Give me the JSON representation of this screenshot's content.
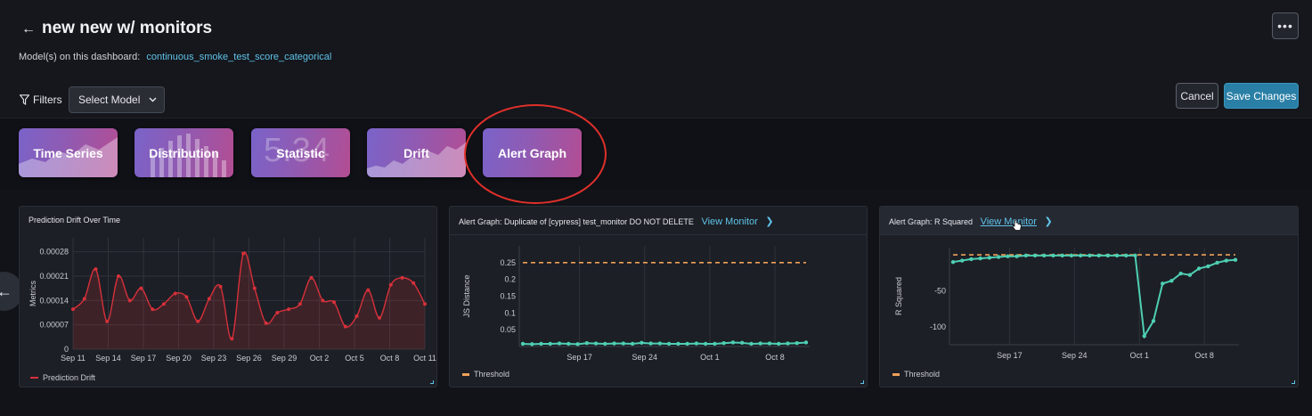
{
  "header": {
    "back_icon": "arrow-left-icon",
    "title": "new new w/ monitors",
    "models_label": "Model(s) on this dashboard:",
    "model_link": "continuous_smoke_test_score_categorical",
    "more_icon": "ellipsis-icon",
    "more_label": "•••"
  },
  "filters": {
    "icon": "funnel-icon",
    "label": "Filters",
    "select_label": "Select Model",
    "select_icon": "chevron-down-icon"
  },
  "actions": {
    "cancel_label": "Cancel",
    "save_label": "Save Changes"
  },
  "widgets": [
    {
      "label": "Time Series"
    },
    {
      "label": "Distribution"
    },
    {
      "label": "Statistic",
      "bg_text": "5.34"
    },
    {
      "label": "Drift"
    },
    {
      "label": "Alert Graph"
    }
  ],
  "colors": {
    "accent": "#5fc3ea",
    "drift_line": "#d6303a",
    "alert_line": "#4ecfb3",
    "threshold": "#f0a05a",
    "highlight": "#e0302a"
  },
  "panels": {
    "drift": {
      "title": "Prediction Drift Over Time",
      "legend": "Prediction Drift"
    },
    "alert_js": {
      "title": "Alert Graph: Duplicate of [cypress] test_monitor DO NOT DELETE",
      "link": "View Monitor",
      "legend": "Threshold"
    },
    "alert_r2": {
      "title": "Alert Graph: R Squared",
      "link": "View Monitor",
      "legend": "Threshold"
    }
  },
  "chart_data": [
    {
      "type": "line",
      "title": "Prediction Drift Over Time",
      "ylabel": "Metrics",
      "xlabel": "",
      "x_ticks": [
        "Sep 11",
        "Sep 14",
        "Sep 17",
        "Sep 20",
        "Sep 23",
        "Sep 26",
        "Sep 29",
        "Oct 2",
        "Oct 5",
        "Oct 8",
        "Oct 11"
      ],
      "y_ticks": [
        "0",
        "0.00007",
        "0.00014",
        "0.00021",
        "0.00028"
      ],
      "ylim": [
        0,
        0.00032
      ],
      "xlim": [
        0,
        31
      ],
      "series": [
        {
          "name": "Prediction Drift",
          "x": [
            0,
            1,
            2,
            3,
            4,
            5,
            6,
            7,
            8,
            9,
            10,
            11,
            12,
            13,
            14,
            15,
            16,
            17,
            18,
            19,
            20,
            21,
            22,
            23,
            24,
            25,
            26,
            27,
            28,
            29,
            30,
            31
          ],
          "y": [
            0.000115,
            0.000145,
            0.00023,
            8e-05,
            0.00021,
            0.00014,
            0.000175,
            0.000115,
            0.00013,
            0.00016,
            0.00015,
            8e-05,
            0.000145,
            0.00018,
            3e-05,
            0.000275,
            0.000175,
            7.5e-05,
            0.000105,
            0.000115,
            0.00013,
            0.000205,
            0.00014,
            0.000135,
            6.5e-05,
            9.5e-05,
            0.00017,
            9e-05,
            0.000185,
            0.000205,
            0.00019,
            0.00013
          ]
        }
      ]
    },
    {
      "type": "line",
      "title": "Alert Graph: Duplicate of [cypress] test_monitor DO NOT DELETE",
      "ylabel": "JS Distance",
      "xlabel": "",
      "x_ticks": [
        "Sep 17",
        "Sep 24",
        "Oct 1",
        "Oct 8"
      ],
      "y_ticks": [
        "0.05",
        "0.1",
        "0.15",
        "0.2",
        "0.25"
      ],
      "ylim": [
        0,
        0.3
      ],
      "threshold": 0.25,
      "series": [
        {
          "name": "",
          "x": [
            0,
            1,
            2,
            3,
            4,
            5,
            6,
            7,
            8,
            9,
            10,
            11,
            12,
            13,
            14,
            15,
            16,
            17,
            18,
            19,
            20,
            21,
            22,
            23,
            24,
            25,
            26,
            27,
            28,
            29,
            30,
            31
          ],
          "y": [
            0.008,
            0.007,
            0.008,
            0.008,
            0.009,
            0.008,
            0.007,
            0.01,
            0.009,
            0.008,
            0.009,
            0.009,
            0.008,
            0.011,
            0.009,
            0.009,
            0.008,
            0.008,
            0.008,
            0.009,
            0.008,
            0.008,
            0.01,
            0.012,
            0.011,
            0.008,
            0.009,
            0.009,
            0.008,
            0.009,
            0.01,
            0.012
          ]
        }
      ]
    },
    {
      "type": "line",
      "title": "Alert Graph: R Squared",
      "ylabel": "R Squared",
      "xlabel": "",
      "x_ticks": [
        "Sep 17",
        "Sep 24",
        "Oct 1",
        "Oct 8"
      ],
      "y_ticks": [
        "-50",
        "-100"
      ],
      "ylim": [
        -125,
        10
      ],
      "threshold": 0,
      "series": [
        {
          "name": "",
          "x": [
            0,
            1,
            2,
            3,
            4,
            5,
            6,
            7,
            8,
            9,
            10,
            11,
            12,
            13,
            14,
            15,
            16,
            17,
            18,
            19,
            20,
            21,
            22,
            23,
            24,
            25,
            26,
            27,
            28,
            29,
            30,
            31
          ],
          "y": [
            -10,
            -8,
            -6,
            -5,
            -4,
            -3,
            -2,
            -2,
            -1,
            -1,
            -1,
            -1,
            -1,
            -1,
            -1,
            -1,
            -1,
            -1,
            -1,
            -1,
            -1,
            -113,
            -92,
            -40,
            -36,
            -26,
            -28,
            -19,
            -16,
            -11,
            -8,
            -7
          ]
        }
      ]
    }
  ]
}
